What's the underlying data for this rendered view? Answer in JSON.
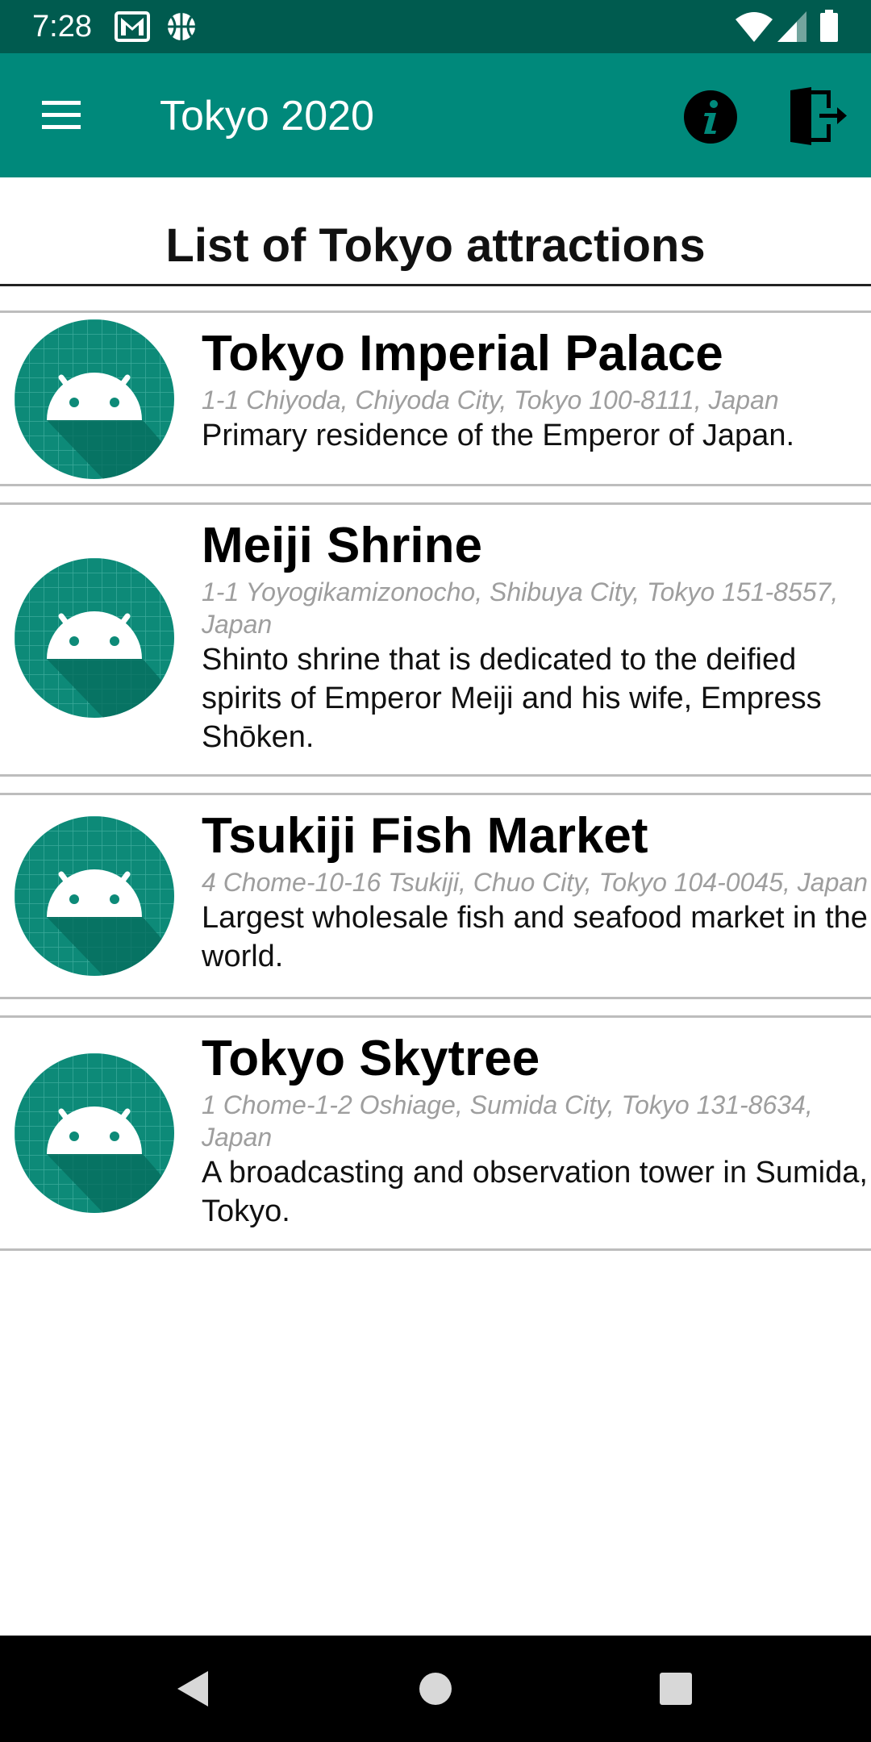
{
  "status_bar": {
    "time": "7:28",
    "left_icons": [
      "gmail-icon",
      "basketball-icon"
    ],
    "right_icons": [
      "wifi-icon",
      "signal-icon",
      "battery-icon"
    ]
  },
  "app_bar": {
    "title": "Tokyo 2020",
    "color": "#00897b",
    "status_color": "#005b4f",
    "icons": [
      "menu-icon",
      "info-icon",
      "exit-icon"
    ]
  },
  "page": {
    "heading": "List of Tokyo attractions"
  },
  "attractions": [
    {
      "name": "Tokyo Imperial Palace",
      "address": "1-1 Chiyoda, Chiyoda City, Tokyo 100-8111, Japan",
      "description": "Primary residence of the Emperor of Japan.",
      "icon": "android-icon"
    },
    {
      "name": "Meiji Shrine",
      "address": "1-1 Yoyogikamizonocho, Shibuya City, Tokyo 151-8557, Japan",
      "description": "Shinto shrine that is dedicated to the deified spirits of Emperor Meiji and his wife, Empress Shōken.",
      "icon": "android-icon"
    },
    {
      "name": "Tsukiji Fish Market",
      "address": "4 Chome-10-16 Tsukiji, Chuo City, Tokyo 104-0045, Japan",
      "description": "Largest wholesale fish and seafood market in the world.",
      "icon": "android-icon"
    },
    {
      "name": "Tokyo Skytree",
      "address": "1 Chome-1-2 Oshiage, Sumida City, Tokyo 131-8634, Japan",
      "description": "A broadcasting and observation tower in Sumida, Tokyo.",
      "icon": "android-icon"
    }
  ],
  "nav_bar": {
    "buttons": [
      "back-icon",
      "home-icon",
      "recents-icon"
    ]
  }
}
